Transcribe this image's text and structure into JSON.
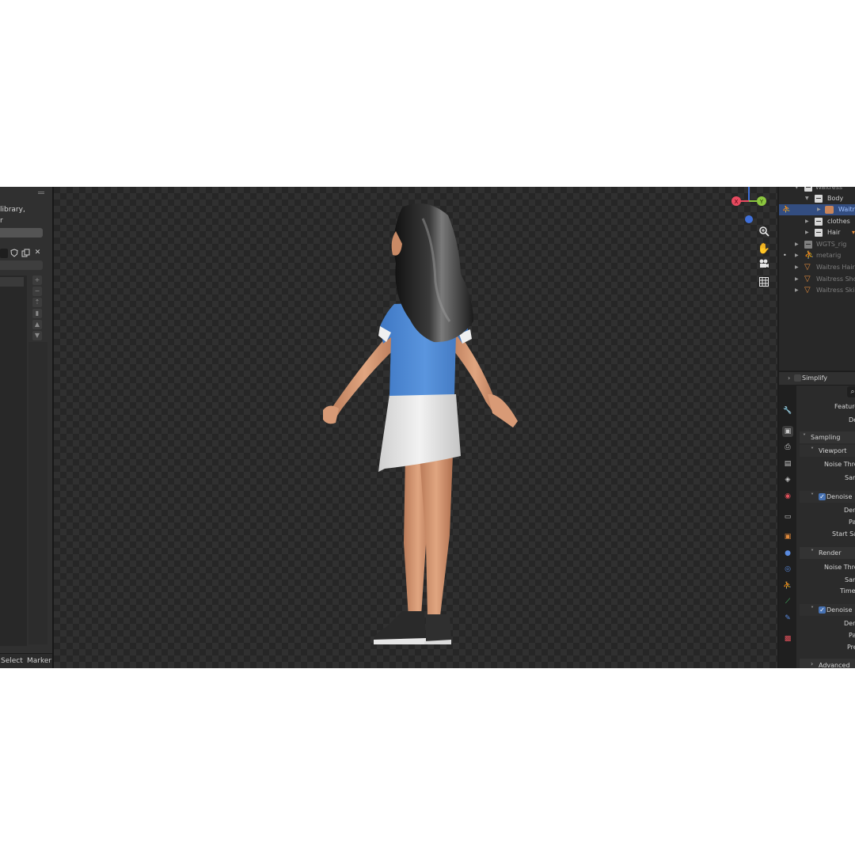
{
  "left_panel": {
    "library_text": "library,",
    "r_text": "r",
    "icons": [
      "shield-icon",
      "duplicate-icon",
      "close-icon"
    ],
    "side_buttons": [
      "+",
      "−",
      "⇡",
      "▮",
      "▲",
      "▼"
    ],
    "footer": {
      "select": "Select",
      "marker": "Marker"
    }
  },
  "viewport": {
    "gizmo": {
      "x_label": "X",
      "y_label": "Y"
    },
    "tools": [
      "zoom-icon",
      "hand-pan-icon",
      "camera-icon",
      "grid-icon"
    ]
  },
  "outliner": {
    "rows": [
      {
        "label": "Waitress",
        "indent": 1,
        "icon": "collection",
        "dim": false
      },
      {
        "label": "Body",
        "indent": 2,
        "icon": "collection",
        "dim": false
      },
      {
        "label": "Waitr",
        "indent": 3,
        "icon": "armature",
        "dim": false,
        "selected": true
      },
      {
        "label": "clothes",
        "indent": 2,
        "icon": "collection",
        "dim": false
      },
      {
        "label": "Hair",
        "indent": 2,
        "icon": "collection",
        "dim": false
      },
      {
        "label": "WGTS_rig",
        "indent": 1,
        "icon": "collection",
        "dim": true
      },
      {
        "label": "metarig",
        "indent": 1,
        "icon": "armature",
        "dim": true
      },
      {
        "label": "Waitres Hair l",
        "indent": 1,
        "icon": "mesh",
        "dim": true
      },
      {
        "label": "Waitress Shoe",
        "indent": 1,
        "icon": "mesh",
        "dim": true
      },
      {
        "label": "Waitress Skirt",
        "indent": 1,
        "icon": "mesh",
        "dim": true
      }
    ]
  },
  "properties": {
    "simplify": "Simplify",
    "feature_label": "Feature",
    "de_label": "De",
    "sampling": "Sampling",
    "viewport_section": "Viewport",
    "noise_threshold": "Noise Thres",
    "samples": "Sam",
    "denoise": "Denoise",
    "denoiser": "Den",
    "passes": "Pa",
    "start_sample": "Start Sa",
    "render_section": "Render",
    "noise_threshold_2": "Noise Thres",
    "samples_2": "Sam",
    "time": "Time",
    "denoise_2": "Denoise",
    "denoiser_2": "Den",
    "passes_2": "Pa",
    "prefilter": "Pre",
    "advanced": "Advanced"
  },
  "colors": {
    "accent_selected": "#334d80",
    "checkbox": "#4772b3",
    "gizmo_x": "#e84a5f",
    "gizmo_y": "#8cc63f",
    "gizmo_z": "#3f6fd8"
  }
}
